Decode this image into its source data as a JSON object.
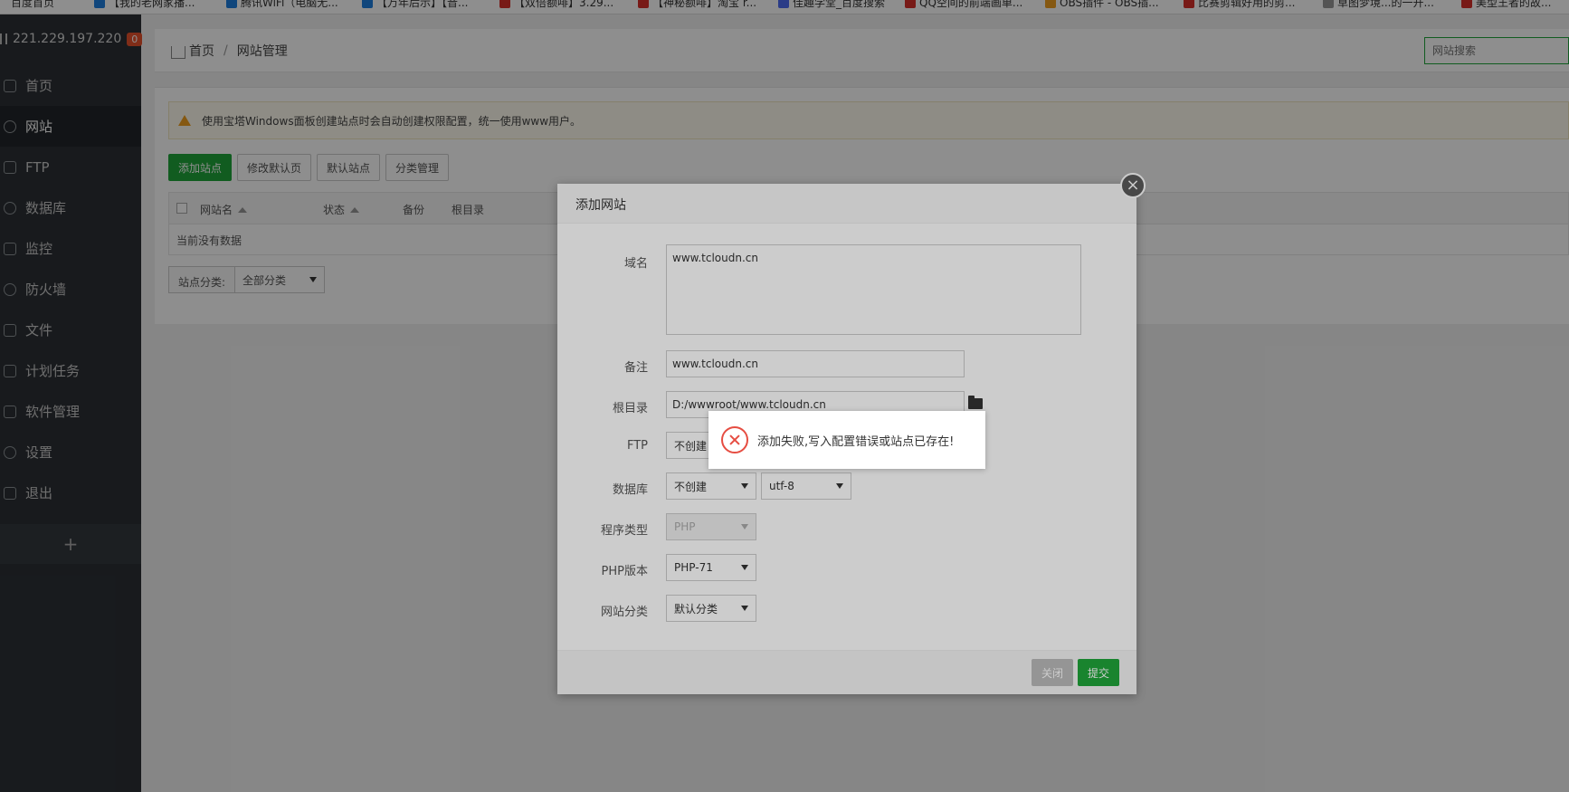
{
  "bookmarks": [
    {
      "label": "百度首页"
    },
    {
      "label": "【我的老网家播..."
    },
    {
      "label": "腾讯WiFi（电脑无..."
    },
    {
      "label": "【万年后示】【音..."
    },
    {
      "label": "【双倍额啡】3.29..."
    },
    {
      "label": "【神秘额啡】淘宝 r..."
    },
    {
      "label": "佳趣学堂_百度搜索"
    },
    {
      "label": "QQ空间的前端画单..."
    },
    {
      "label": "OBS插件 - OBS插..."
    },
    {
      "label": "比赛剪辑好用的剪..."
    },
    {
      "label": "草图梦境...的一开..."
    },
    {
      "label": "美型王者的故..."
    }
  ],
  "sidebar": {
    "ip": "221.229.197.220",
    "badge": "0",
    "items": [
      {
        "label": "首页"
      },
      {
        "label": "网站"
      },
      {
        "label": "FTP"
      },
      {
        "label": "数据库"
      },
      {
        "label": "监控"
      },
      {
        "label": "防火墙"
      },
      {
        "label": "文件"
      },
      {
        "label": "计划任务"
      },
      {
        "label": "软件管理"
      },
      {
        "label": "设置"
      },
      {
        "label": "退出"
      }
    ],
    "add_label": "+"
  },
  "breadcrumb": {
    "home": "首页",
    "sep": "/",
    "current": "网站管理"
  },
  "search": {
    "placeholder": "网站搜索"
  },
  "alert": {
    "text": "使用宝塔Windows面板创建站点时会自动创建权限配置，统一使用www用户。"
  },
  "toolbar": {
    "add_site": "添加站点",
    "edit_default_page": "修改默认页",
    "default_site": "默认站点",
    "category_manage": "分类管理"
  },
  "table": {
    "columns": [
      "网站名",
      "状态",
      "备份",
      "根目录"
    ],
    "empty": "当前没有数据"
  },
  "category": {
    "label": "站点分类:",
    "value": "全部分类"
  },
  "dialog": {
    "title": "添加网站",
    "close": "×",
    "fields": {
      "domain_label": "域名",
      "domain_value": "www.tcloudn.cn",
      "remark_label": "备注",
      "remark_value": "www.tcloudn.cn",
      "root_label": "根目录",
      "root_value": "D:/wwwroot/www.tcloudn.cn",
      "ftp_label": "FTP",
      "ftp_value": "不创建",
      "db_label": "数据库",
      "db_value": "不创建",
      "db_charset": "utf-8",
      "program_label": "程序类型",
      "program_value": "PHP",
      "php_label": "PHP版本",
      "php_value": "PHP-71",
      "cat_label": "网站分类",
      "cat_value": "默认分类"
    },
    "cancel": "关闭",
    "submit": "提交"
  },
  "toast": {
    "message": "添加失败,写入配置错误或站点已存在!"
  },
  "colors": {
    "accent": "#20a53a",
    "sidebar_bg": "#2b3035",
    "error": "#e64d42",
    "badge": "#e6522c"
  }
}
